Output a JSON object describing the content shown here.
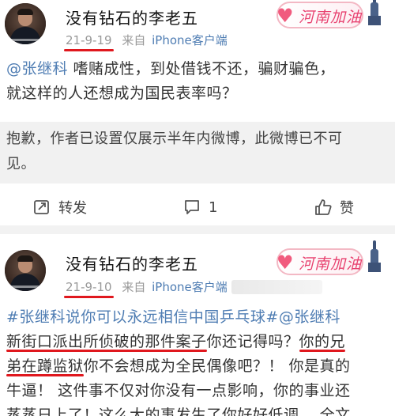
{
  "posts": [
    {
      "username": "没有钻石的李老五",
      "date": "21-9-19",
      "source": "来自",
      "device": "iPhone客户端",
      "badge_text": "河南加油",
      "mention": "@张继科",
      "text_line1_rest": " 嗜赌成性，到处借钱不还，骗财骗色，",
      "text_line2": "就这样的人还想成为国民表率吗？",
      "notice_line1": "抱歉，作者已设置仅展示半年内微博，此微博已不可",
      "notice_line2": "见。",
      "repost_label": "转发",
      "comment_count": "1",
      "like_label": "赞"
    },
    {
      "username": "没有钻石的李老五",
      "date": "21-9-10",
      "source": "来自",
      "device": "iPhone客户端",
      "badge_text": "河南加油",
      "hashtag": "#张继科说你可以永远相信中国乒乓球#",
      "mention": "@张继科",
      "seg1": "新街口派出所侦破的那件案子",
      "seg2": "你还记得吗？",
      "seg3": "你的兄",
      "seg4": "弟在蹲监狱",
      "seg5": "你不会想成为全民偶像吧？！ 你是真的",
      "line4": "牛逼！ 这件事不仅对你没有一点影响，你的事业还",
      "line5": "蒸蒸日上了！这么大的事发生了你好好低调 ...全文"
    }
  ]
}
